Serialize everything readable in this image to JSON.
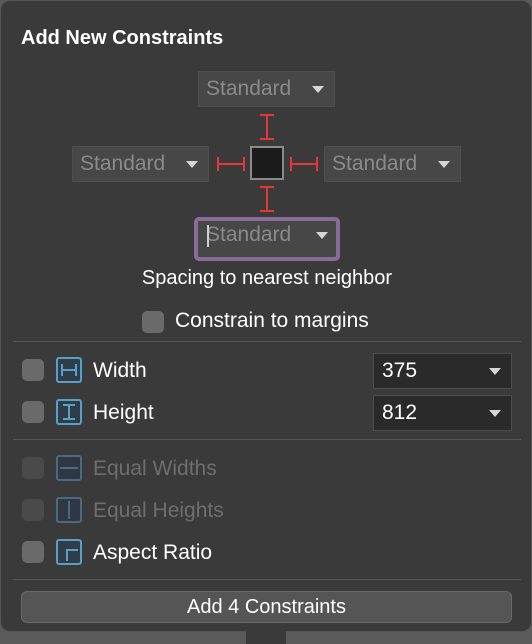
{
  "title": "Add New Constraints",
  "spacing": {
    "top": "Standard",
    "left": "Standard",
    "right": "Standard",
    "bottom": "Standard"
  },
  "spacing_caption": "Spacing to nearest neighbor",
  "constrain_margins": {
    "label": "Constrain to margins",
    "checked": false
  },
  "size": {
    "width": {
      "label": "Width",
      "value": "375",
      "checked": false
    },
    "height": {
      "label": "Height",
      "value": "812",
      "checked": false
    }
  },
  "equal": {
    "widths": {
      "label": "Equal Widths",
      "enabled": false
    },
    "heights": {
      "label": "Equal Heights",
      "enabled": false
    },
    "aspect": {
      "label": "Aspect Ratio",
      "enabled": true,
      "checked": false
    }
  },
  "add_button": "Add 4 Constraints",
  "colors": {
    "constraint_line": "#e5373a",
    "focus_ring": "#8a6a9a",
    "icon_accent": "#5a9fc7"
  }
}
